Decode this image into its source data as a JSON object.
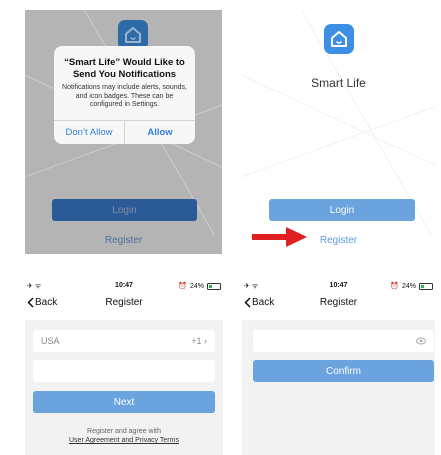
{
  "app": {
    "name": "Smart Life"
  },
  "dialog": {
    "title": "“Smart Life” Would Like to Send You Notifications",
    "message": "Notifications may include alerts, sounds, and icon badges. These can be configured in Settings.",
    "deny_label": "Don’t Allow",
    "allow_label": "Allow"
  },
  "welcome": {
    "login_label": "Login",
    "register_label": "Register"
  },
  "status_bar": {
    "time": "10:47",
    "battery": "24%"
  },
  "register_screen": {
    "back_label": "Back",
    "title": "Register",
    "country_name": "USA",
    "country_code": "+1",
    "phone_value": "",
    "next_label": "Next",
    "agree_text": "Register and agree with",
    "terms_link": "User Agreement and Privacy Terms"
  },
  "password_screen": {
    "back_label": "Back",
    "title": "Register",
    "password_value": "",
    "confirm_label": "Confirm"
  },
  "colors": {
    "accent": "#6aa3de",
    "icon_blue": "#3d8fe6",
    "arrow_red": "#e02020",
    "dialog_link": "#2f7fde"
  },
  "icons": [
    "app-house-icon",
    "red-arrow-icon",
    "airplane-icon",
    "wifi-icon",
    "alarm-icon",
    "battery-icon",
    "chevron-left-icon",
    "chevron-right-icon",
    "eye-icon"
  ]
}
